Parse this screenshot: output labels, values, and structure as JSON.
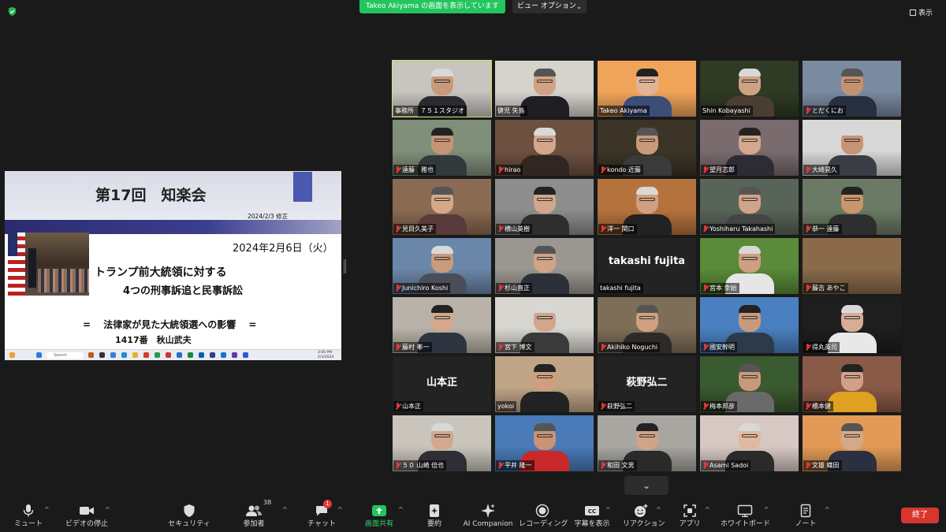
{
  "topbar": {
    "share_banner": "Takeo  Akiyama の画面を表示しています",
    "view_options": "ビュー オプション",
    "show_label": "表示"
  },
  "slide": {
    "title": "第17回　知楽会",
    "revision": "2024/2/3 修正",
    "date": "2024年2月6日（火）",
    "line1": "トランプ前大統領に対する",
    "line2": "4つの刑事訴追と民事訴訟",
    "line3": "=　 法律家が見た大統領選への影響　 =",
    "line4": "1417番　秋山武夫",
    "search_text": "Search",
    "clock": "3:00 PM\n2/3/2024"
  },
  "participants": [
    {
      "name": "事務所　７５１スタジオ",
      "muted": false,
      "active": true,
      "bg": "#c8c4bf",
      "shirt": "#2a2a30",
      "skin": "#c89a7c"
    },
    {
      "name": "健児 矢島",
      "muted": false,
      "bg": "#d6d2cc",
      "shirt": "#1e1e24",
      "skin": "#d2a284"
    },
    {
      "name": "Takeo Akiyama",
      "muted": false,
      "bg": "#f0a45a",
      "shirt": "#3b4e78",
      "skin": "#e1b497"
    },
    {
      "name": "Shin Kobayashi",
      "muted": false,
      "bg": "#2f3b24",
      "shirt": "#4a3e32",
      "skin": "#cfa183"
    },
    {
      "name": "とだくにお",
      "muted": true,
      "bg": "#7a8aa0",
      "shirt": "#26303e",
      "skin": "#c49070"
    },
    {
      "name": "遠藤　雅也",
      "muted": true,
      "bg": "#7f8f7a",
      "shirt": "#31393c",
      "skin": "#c69474"
    },
    {
      "name": "hirao",
      "muted": true,
      "bg": "#6e5040",
      "shirt": "#322622",
      "skin": "#d4a68c"
    },
    {
      "name": "kondo 近藤",
      "muted": true,
      "bg": "#3c3426",
      "shirt": "#3a3a3a",
      "skin": "#c99a7a"
    },
    {
      "name": "望月志郎",
      "muted": true,
      "bg": "#7a6b6e",
      "shirt": "#2e2b34",
      "skin": "#d3a88e"
    },
    {
      "name": "大崎晃久",
      "muted": true,
      "bg": "#d8d8d8",
      "shirt": "#3a3d45",
      "skin": "#c79476"
    },
    {
      "name": "見目久美子",
      "muted": true,
      "bg": "#8a6a52",
      "shirt": "#5a3a3a",
      "skin": "#d6a88a"
    },
    {
      "name": "横山英樹",
      "muted": true,
      "bg": "#8d8d8d",
      "shirt": "#2e2e2e",
      "skin": "#d0a68c"
    },
    {
      "name": "洋一 関口",
      "muted": true,
      "bg": "#b6723c",
      "shirt": "#222",
      "skin": "#d1a082"
    },
    {
      "name": "Yoshiharu Takahashi",
      "muted": true,
      "bg": "#586458",
      "shirt": "#444",
      "skin": "#d0a48a"
    },
    {
      "name": "恭一 遠藤",
      "muted": true,
      "bg": "#6a7a64",
      "shirt": "#2e2e2e",
      "skin": "#c8966c"
    },
    {
      "name": "Junichiro Koshi",
      "muted": true,
      "bg": "#6a86a8",
      "shirt": "#4a4e58",
      "skin": "#c99a7c"
    },
    {
      "name": "杉山直正",
      "muted": true,
      "bg": "#9a9690",
      "shirt": "#2b2f38",
      "skin": "#d0a488"
    },
    {
      "name": "takashi fujita",
      "muted": false,
      "bg": "#232323",
      "shirt": "",
      "skin": "",
      "placeholder": "takashi fujita"
    },
    {
      "name": "宮本 幸始",
      "muted": true,
      "bg": "#5a8a3a",
      "shirt": "#e6e6e6",
      "skin": "#cf9f82"
    },
    {
      "name": "藤吉 あやこ",
      "muted": true,
      "bg": "#8a6a4a",
      "shirt": "",
      "skin": "",
      "empty": true
    },
    {
      "name": "藤村 峯一",
      "muted": true,
      "bg": "#b8b2a8",
      "shirt": "#2e3440",
      "skin": "#d3a88c"
    },
    {
      "name": "宮下 博文",
      "muted": true,
      "bg": "#d8d6d0",
      "shirt": "#3a3a3a",
      "skin": "#d1a68c"
    },
    {
      "name": "Akihiko Noguchi",
      "muted": true,
      "bg": "#7e6e58",
      "shirt": "#2e2a28",
      "skin": "#d0a080"
    },
    {
      "name": "國安幹明",
      "muted": true,
      "bg": "#4a80c0",
      "shirt": "#2d3a4a",
      "skin": "#c89a7a"
    },
    {
      "name": "得丸英司",
      "muted": true,
      "bg": "#1e1e1e",
      "shirt": "#e8e8e8",
      "skin": "#d6ae96"
    },
    {
      "name": "山本正",
      "muted": true,
      "bg": "#232323",
      "shirt": "",
      "skin": "",
      "placeholder": "山本正"
    },
    {
      "name": "yokoi",
      "muted": false,
      "bg": "#bfa486",
      "shirt": "#222",
      "skin": "#d19e80"
    },
    {
      "name": "萩野弘二",
      "muted": true,
      "bg": "#232323",
      "shirt": "",
      "skin": "",
      "placeholder": "萩野弘二"
    },
    {
      "name": "梅本邦彦",
      "muted": true,
      "bg": "#3a5a30",
      "shirt": "#6a6a6a",
      "skin": "#c9987a"
    },
    {
      "name": "橋本健",
      "muted": true,
      "bg": "#8a5a48",
      "shirt": "#e0a020",
      "skin": "#d2a088"
    },
    {
      "name": "５０ 山崎 倍也",
      "muted": true,
      "bg": "#c9c4bc",
      "shirt": "#2e2e34",
      "skin": "#d3a88c"
    },
    {
      "name": "平井 隆一",
      "muted": true,
      "bg": "#4a7ab8",
      "shirt": "#c8282a",
      "skin": "#c99474"
    },
    {
      "name": "和田 文男",
      "muted": true,
      "bg": "#a8a6a0",
      "shirt": "#2a2a2a",
      "skin": "#d0a488"
    },
    {
      "name": "Asami Sadoi",
      "muted": true,
      "bg": "#d8c8c4",
      "shirt": "#2a2a2a",
      "skin": "#e2b8a0"
    },
    {
      "name": "文雄 織田",
      "muted": true,
      "bg": "#e39a56",
      "shirt": "#2a3040",
      "skin": "#d6a88a"
    }
  ],
  "toolbar": {
    "items": [
      {
        "label": "ミュート"
      },
      {
        "label": "ビデオの停止"
      },
      {
        "label": "セキュリティ"
      },
      {
        "label": "参加者",
        "count": "38"
      },
      {
        "label": "チャット",
        "badge": "1"
      },
      {
        "label": "画面共有"
      },
      {
        "label": "要約"
      },
      {
        "label": "AI Companion"
      },
      {
        "label": "レコーディング"
      },
      {
        "label": "字幕を表示"
      },
      {
        "label": "リアクション"
      },
      {
        "label": "アプリ"
      },
      {
        "label": "ホワイトボード"
      },
      {
        "label": "ノート"
      }
    ],
    "end_label": "終了"
  },
  "colors": {
    "share_green": "#22c55e",
    "end_red": "#d9352f",
    "active_speaker": "#c9e46a",
    "muted_icon": "#e03a3a"
  }
}
